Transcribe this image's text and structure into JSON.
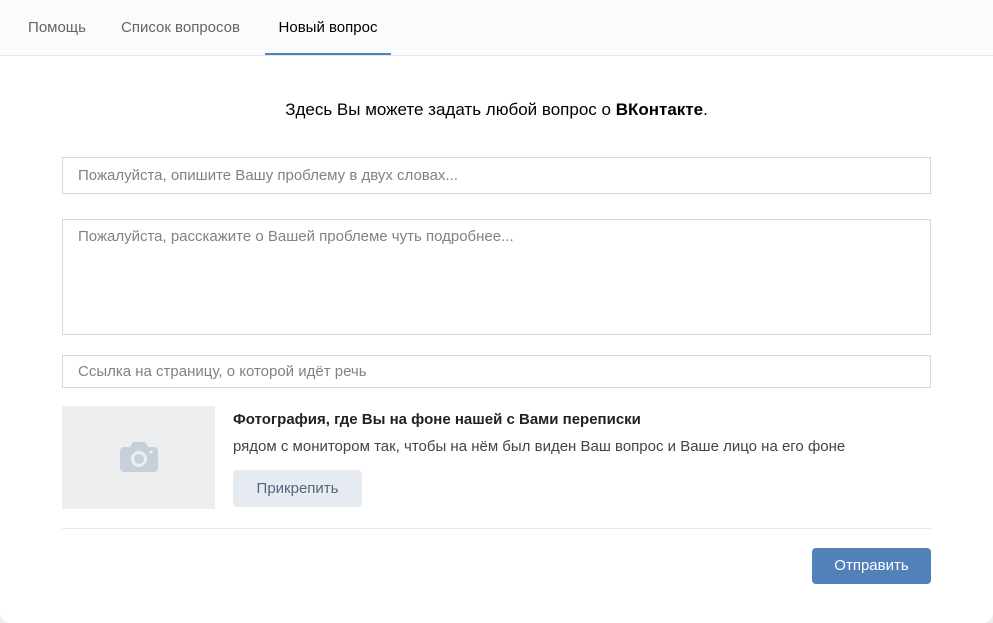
{
  "tabs": [
    {
      "label": "Помощь"
    },
    {
      "label": "Список вопросов"
    },
    {
      "label": "Новый вопрос",
      "active": true
    }
  ],
  "intro": {
    "prefix": "Здесь Вы можете задать любой вопрос о ",
    "brand": "ВКонтакте",
    "suffix": "."
  },
  "form": {
    "title_placeholder": "Пожалуйста, опишите Вашу проблему в двух словах...",
    "details_placeholder": "Пожалуйста, расскажите о Вашей проблеме чуть подробнее...",
    "link_placeholder": "Ссылка на страницу, о которой идёт речь"
  },
  "photo": {
    "title": "Фотография, где Вы на фоне нашей с Вами переписки",
    "description": "рядом с монитором так, чтобы на нём был виден Ваш вопрос и Ваше лицо на его фоне",
    "attach_label": "Прикрепить",
    "icon": "camera-icon"
  },
  "submit": {
    "label": "Отправить"
  },
  "colors": {
    "accent": "#5181b8",
    "secondary_button": "#e5ebf1",
    "photo_placeholder_bg": "#edeef0"
  }
}
